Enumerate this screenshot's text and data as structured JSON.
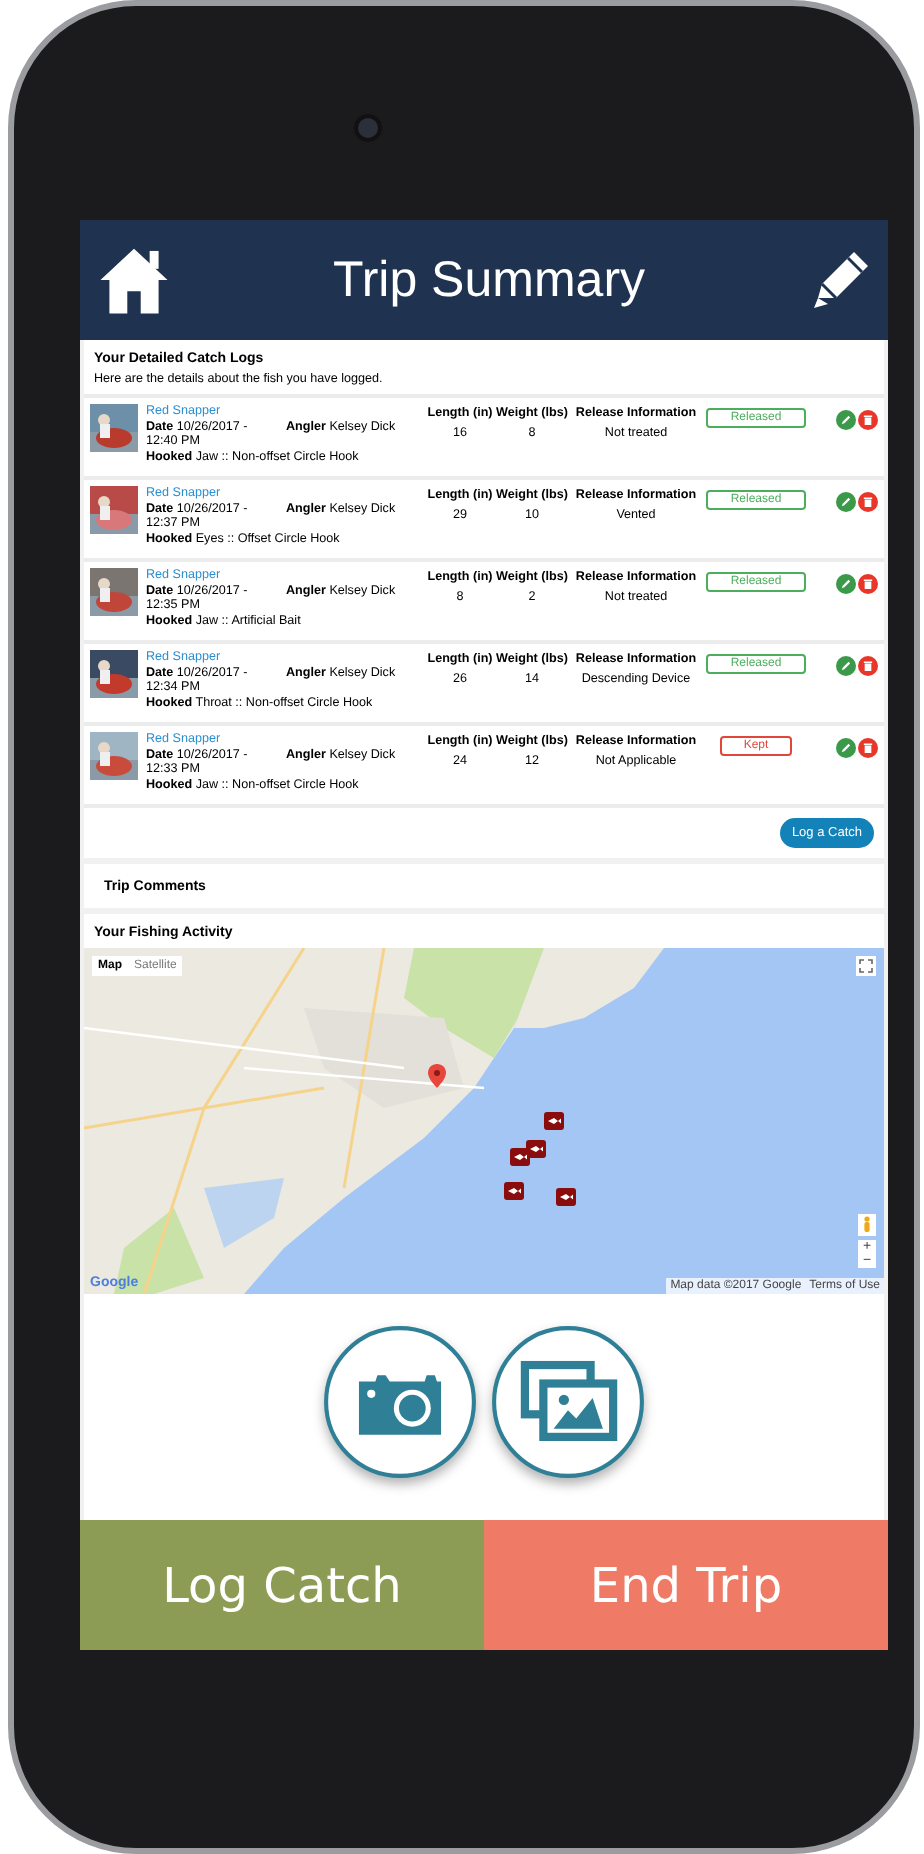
{
  "header": {
    "title": "Trip Summary"
  },
  "catch_logs": {
    "title": "Your Detailed Catch Logs",
    "subtitle": "Here are the details about the fish you have logged.",
    "rows": [
      {
        "species": "Red Snapper",
        "date": "**Date** 10/26/2017 - 12:40 PM",
        "angler": "**Angler** Kelsey Dick",
        "hooked": "**Hooked** Jaw :: Non-offset Circle Hook",
        "length_label": "Length (in)",
        "length": "16",
        "weight_label": "Weight (lbs)",
        "weight": "8",
        "release_label": "Release Information",
        "release": "Not treated",
        "status": {
          "label": "Released",
          "kind": "released"
        }
      },
      {
        "species": "Red Snapper",
        "date": "**Date** 10/26/2017 - 12:37 PM",
        "angler": "**Angler** Kelsey Dick",
        "hooked": "**Hooked** Eyes :: Offset Circle Hook",
        "length_label": "Length (in)",
        "length": "29",
        "weight_label": "Weight (lbs)",
        "weight": "10",
        "release_label": "Release Information",
        "release": "Vented",
        "status": {
          "label": "Released",
          "kind": "released"
        }
      },
      {
        "species": "Red Snapper",
        "date": "**Date** 10/26/2017 - 12:35 PM",
        "angler": "**Angler** Kelsey Dick",
        "hooked": "**Hooked** Jaw :: Artificial Bait",
        "length_label": "Length (in)",
        "length": "8",
        "weight_label": "Weight (lbs)",
        "weight": "2",
        "release_label": "Release Information",
        "release": "Not treated",
        "status": {
          "label": "Released",
          "kind": "released"
        }
      },
      {
        "species": "Red Snapper",
        "date": "**Date** 10/26/2017 - 12:34 PM",
        "angler": "**Angler** Kelsey Dick",
        "hooked": "**Hooked** Throat :: Non-offset Circle Hook",
        "length_label": "Length (in)",
        "length": "26",
        "weight_label": "Weight (lbs)",
        "weight": "14",
        "release_label": "Release Information",
        "release": "Descending Device",
        "status": {
          "label": "Released",
          "kind": "released"
        }
      },
      {
        "species": "Red Snapper",
        "date": "**Date** 10/26/2017 - 12:33 PM",
        "angler": "**Angler** Kelsey Dick",
        "hooked": "**Hooked** Jaw :: Non-offset Circle Hook",
        "length_label": "Length (in)",
        "length": "24",
        "weight_label": "Weight (lbs)",
        "weight": "12",
        "release_label": "Release Information",
        "release": "Not Applicable",
        "status": {
          "label": "Kept",
          "kind": "kept"
        }
      }
    ],
    "action": "Log a Catch"
  },
  "comments": {
    "title": "Trip Comments"
  },
  "activity": {
    "title": "Your Fishing Activity",
    "map": {
      "kind": "picture",
      "types": [
        {
          "label": "Map",
          "selected": true
        },
        {
          "label": "Satellite",
          "selected": false
        }
      ],
      "logo": "Google",
      "attribution": "Map data ©2017 Google",
      "terms": "Terms of Use",
      "zoom_in": "+",
      "zoom_out": "−"
    }
  },
  "bottom_buttons": [
    {
      "label": "Log Catch",
      "kind": "log"
    },
    {
      "label": "End Trip",
      "kind": "end"
    }
  ]
}
